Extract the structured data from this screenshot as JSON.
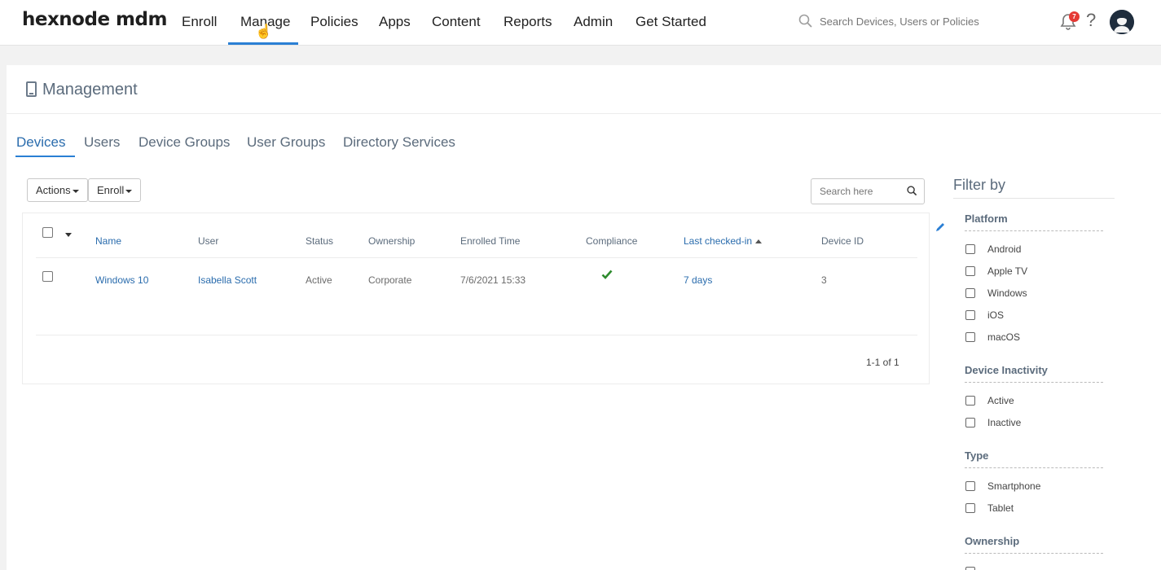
{
  "topnav": {
    "logo": "hexnode mdm",
    "items": [
      "Enroll",
      "Manage",
      "Policies",
      "Apps",
      "Content",
      "Reports",
      "Admin",
      "Get Started"
    ],
    "search_placeholder": "Search Devices, Users or Policies",
    "notification_count": "7",
    "help": "?"
  },
  "page": {
    "title": "Management",
    "tabs": [
      "Devices",
      "Users",
      "Device Groups",
      "User Groups",
      "Directory Services"
    ],
    "active_tab": "Devices"
  },
  "toolbar": {
    "actions_label": "Actions",
    "enroll_label": "Enroll",
    "search_placeholder": "Search here"
  },
  "table": {
    "columns": [
      "Name",
      "User",
      "Status",
      "Ownership",
      "Enrolled Time",
      "Compliance",
      "Last checked-in",
      "Device ID"
    ],
    "sorted_column": "Last checked-in",
    "rows": [
      {
        "name": "Windows 10",
        "user": "Isabella Scott",
        "status": "Active",
        "ownership": "Corporate",
        "enrolled_time": "7/6/2021 15:33",
        "compliance": "compliant",
        "last_checked_in": "7 days",
        "device_id": "3"
      }
    ],
    "pagination": "1-1 of 1"
  },
  "filter": {
    "title": "Filter by",
    "groups": [
      {
        "name": "Platform",
        "options": [
          "Android",
          "Apple TV",
          "Windows",
          "iOS",
          "macOS"
        ]
      },
      {
        "name": "Device Inactivity",
        "options": [
          "Active",
          "Inactive"
        ]
      },
      {
        "name": "Type",
        "options": [
          "Smartphone",
          "Tablet"
        ]
      },
      {
        "name": "Ownership",
        "options": []
      }
    ]
  },
  "colors": {
    "accent": "#2a7fd4",
    "link": "#2a6cad",
    "badge": "#e53935",
    "compliant": "#2e8b2e"
  }
}
